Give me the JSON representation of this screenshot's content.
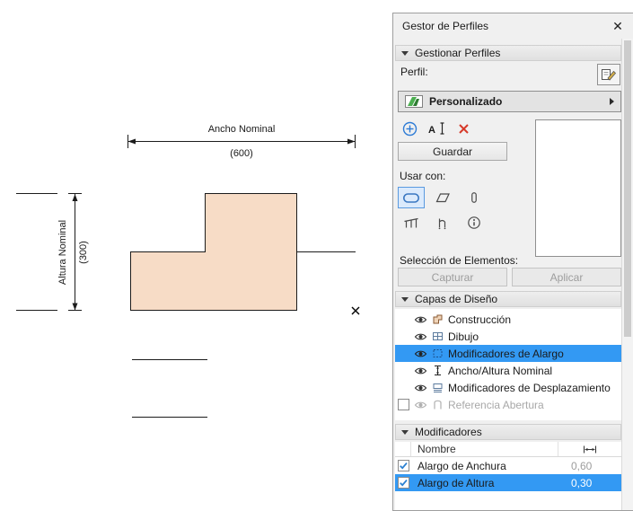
{
  "panel": {
    "title": "Gestor de Perfiles",
    "close_glyph": "✕",
    "manage_section": "Gestionar Perfiles",
    "profile_label": "Perfil:",
    "profile_selected": "Personalizado",
    "save_button": "Guardar",
    "use_with_label": "Usar con:",
    "selection_label": "Selección de Elementos:",
    "capture_button": "Capturar",
    "apply_button": "Aplicar",
    "layers_section": "Capas de Diseño",
    "layers": [
      {
        "label": "Construcción",
        "visible": true
      },
      {
        "label": "Dibujo",
        "visible": true
      },
      {
        "label": "Modificadores de Alargo",
        "visible": true,
        "selected": true
      },
      {
        "label": "Ancho/Altura Nominal",
        "visible": true
      },
      {
        "label": "Modificadores de Desplazamiento",
        "visible": true
      },
      {
        "label": "Referencia Abertura",
        "visible": false,
        "disabled": true
      }
    ],
    "modifiers_section": "Modificadores",
    "table": {
      "name_header": "Nombre",
      "rows": [
        {
          "name": "Alargo de Anchura",
          "value": "0,60",
          "checked": true
        },
        {
          "name": "Alargo de Altura",
          "value": "0,30",
          "checked": true,
          "selected": true
        }
      ]
    }
  },
  "canvas": {
    "width_label": "Ancho Nominal",
    "width_value": "(600)",
    "height_label": "Altura Nominal",
    "height_value": "(300)"
  },
  "colors": {
    "selection_blue": "#3399f3",
    "profile_fill": "#f7dcc6",
    "delete_red": "#d63a2a",
    "add_blue": "#2e7cd6"
  }
}
